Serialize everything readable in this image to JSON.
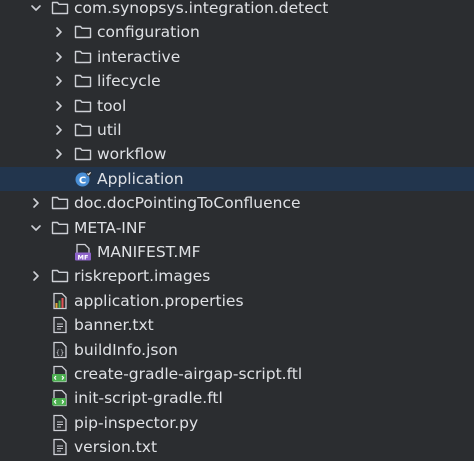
{
  "project_tree": {
    "items": [
      {
        "label": "com.synopsys.integration.detect",
        "kind": "package",
        "expanded": true,
        "depth": 0,
        "arrow": true
      },
      {
        "label": "configuration",
        "kind": "folder",
        "expanded": false,
        "depth": 1,
        "arrow": true
      },
      {
        "label": "interactive",
        "kind": "folder",
        "expanded": false,
        "depth": 1,
        "arrow": true
      },
      {
        "label": "lifecycle",
        "kind": "folder",
        "expanded": false,
        "depth": 1,
        "arrow": true
      },
      {
        "label": "tool",
        "kind": "folder",
        "expanded": false,
        "depth": 1,
        "arrow": true
      },
      {
        "label": "util",
        "kind": "folder",
        "expanded": false,
        "depth": 1,
        "arrow": true
      },
      {
        "label": "workflow",
        "kind": "folder",
        "expanded": false,
        "depth": 1,
        "arrow": true
      },
      {
        "label": "Application",
        "kind": "class",
        "selected": true,
        "depth": 1,
        "arrow": false
      },
      {
        "label": "doc.docPointingToConfluence",
        "kind": "folder",
        "expanded": false,
        "depth": 0,
        "arrow": true
      },
      {
        "label": "META-INF",
        "kind": "folder",
        "expanded": true,
        "depth": 0,
        "arrow": true
      },
      {
        "label": "MANIFEST.MF",
        "kind": "manifest",
        "depth": 1,
        "arrow": false
      },
      {
        "label": "riskreport.images",
        "kind": "folder",
        "expanded": false,
        "depth": 0,
        "arrow": true
      },
      {
        "label": "application.properties",
        "kind": "properties",
        "depth": 0,
        "arrow": false
      },
      {
        "label": "banner.txt",
        "kind": "text",
        "depth": 0,
        "arrow": false
      },
      {
        "label": "buildInfo.json",
        "kind": "json",
        "depth": 0,
        "arrow": false
      },
      {
        "label": "create-gradle-airgap-script.ftl",
        "kind": "template",
        "depth": 0,
        "arrow": false
      },
      {
        "label": "init-script-gradle.ftl",
        "kind": "template",
        "depth": 0,
        "arrow": false
      },
      {
        "label": "pip-inspector.py",
        "kind": "text",
        "depth": 0,
        "arrow": false
      },
      {
        "label": "version.txt",
        "kind": "text",
        "depth": 0,
        "arrow": false
      }
    ],
    "icons": {
      "folder": "folder-icon",
      "package": "folder-icon",
      "class": "java-class-icon",
      "manifest": "manifest-file-icon",
      "properties": "properties-file-icon",
      "text": "text-file-icon",
      "json": "json-file-icon",
      "template": "template-file-icon"
    },
    "colors": {
      "background": "#2b2d30",
      "selection": "#22354d",
      "text": "#dfe1e5",
      "icon": "#ced0d6",
      "class_icon": "#4a8fd6",
      "manifest_badge": "#8d63c9",
      "template_icon": "#4caf50"
    },
    "manifest_badge_text": "MF"
  }
}
